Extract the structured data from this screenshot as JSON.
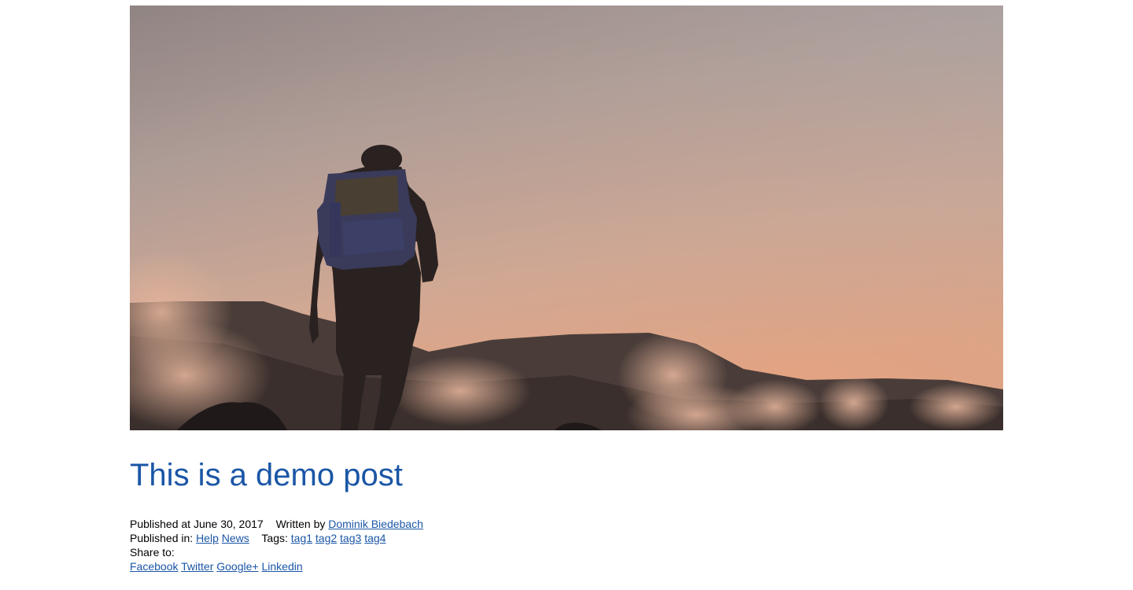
{
  "hero": {
    "alt": "Hiker with backpack silhouetted against a dusk sky above cloud-covered mountains"
  },
  "post": {
    "title": "This is a demo post",
    "published_label": "Published at",
    "published_date": "June 30, 2017",
    "written_label": "Written by",
    "author": "Dominik Biedebach",
    "published_in_label": "Published in:",
    "categories": [
      "Help",
      "News"
    ],
    "tags_label": "Tags:",
    "tags": [
      "tag1",
      "tag2",
      "tag3",
      "tag4"
    ],
    "share_label": "Share to:",
    "share_links": [
      "Facebook",
      "Twitter",
      "Google+",
      "Linkedin"
    ]
  },
  "colors": {
    "link": "#1a56a6",
    "title": "#1a56a6"
  }
}
